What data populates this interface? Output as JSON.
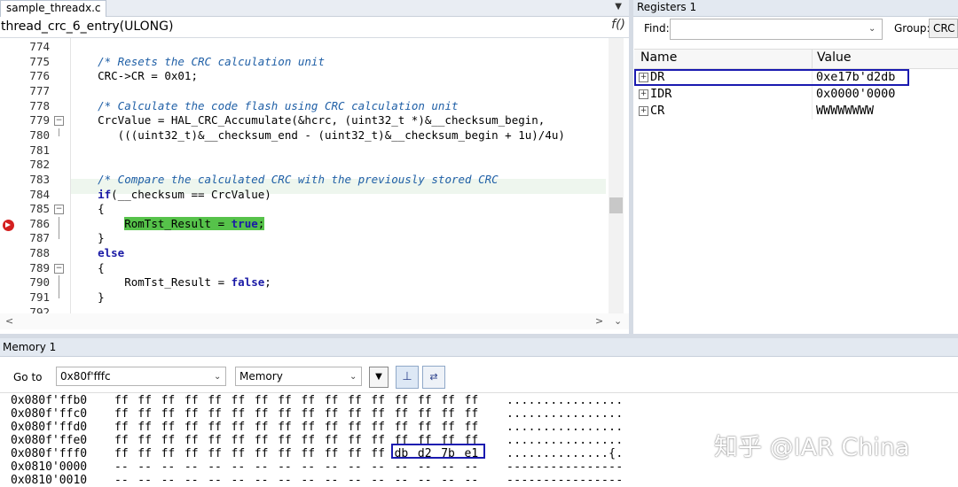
{
  "editor": {
    "tab_label": "sample_threadx.c",
    "tab_dropdown_icon": "▼",
    "function_name": "thread_crc_6_entry(ULONG)",
    "function_icon": "f()",
    "lines": [
      {
        "n": "774",
        "code": ""
      },
      {
        "n": "775",
        "code": "    /* Resets the CRC calculation unit"
      },
      {
        "n": "776",
        "code": "    CRC->CR = 0x01;"
      },
      {
        "n": "777",
        "code": ""
      },
      {
        "n": "778",
        "code": "    /* Calculate the code flash using CRC calculation unit"
      },
      {
        "n": "779",
        "code": "    CrcValue = HAL_CRC_Accumulate(&hcrc, (uint32_t *)&__checksum_begin,"
      },
      {
        "n": "780",
        "code": "       (((uint32_t)&__checksum_end - (uint32_t)&__checksum_begin + 1u)/4u)"
      },
      {
        "n": "781",
        "code": ""
      },
      {
        "n": "782",
        "code": ""
      },
      {
        "n": "783",
        "code": "    /* Compare the calculated CRC with the previously stored CRC"
      },
      {
        "n": "784",
        "code": "    if(__checksum == CrcValue)"
      },
      {
        "n": "785",
        "code": "    {"
      },
      {
        "n": "786",
        "code": "        RomTst_Result = true;"
      },
      {
        "n": "787",
        "code": "    }"
      },
      {
        "n": "788",
        "code": "    else"
      },
      {
        "n": "789",
        "code": "    {"
      },
      {
        "n": "790",
        "code": "        RomTst_Result = false;"
      },
      {
        "n": "791",
        "code": "    }"
      },
      {
        "n": "792",
        "code": ""
      }
    ]
  },
  "registers": {
    "title": "Registers 1",
    "find_label": "Find:",
    "find_value": "",
    "group_label": "Group:",
    "group_value": "CRC",
    "col_name": "Name",
    "col_value": "Value",
    "rows": [
      {
        "name": "DR",
        "value": "0xe17b'd2db"
      },
      {
        "name": "IDR",
        "value": "0x0000'0000"
      },
      {
        "name": "CR",
        "value": "WWWWWWWW"
      }
    ]
  },
  "memory": {
    "title": "Memory 1",
    "goto_label": "Go to",
    "goto_value": "0x80f'fffc",
    "memory_type": "Memory",
    "rows": [
      {
        "addr": "0x080f'ffb0",
        "bytes": [
          "ff",
          "ff",
          "ff",
          "ff",
          "ff",
          "ff",
          "ff",
          "ff",
          "ff",
          "ff",
          "ff",
          "ff",
          "ff",
          "ff",
          "ff",
          "ff"
        ],
        "ascii": "................"
      },
      {
        "addr": "0x080f'ffc0",
        "bytes": [
          "ff",
          "ff",
          "ff",
          "ff",
          "ff",
          "ff",
          "ff",
          "ff",
          "ff",
          "ff",
          "ff",
          "ff",
          "ff",
          "ff",
          "ff",
          "ff"
        ],
        "ascii": "................"
      },
      {
        "addr": "0x080f'ffd0",
        "bytes": [
          "ff",
          "ff",
          "ff",
          "ff",
          "ff",
          "ff",
          "ff",
          "ff",
          "ff",
          "ff",
          "ff",
          "ff",
          "ff",
          "ff",
          "ff",
          "ff"
        ],
        "ascii": "................"
      },
      {
        "addr": "0x080f'ffe0",
        "bytes": [
          "ff",
          "ff",
          "ff",
          "ff",
          "ff",
          "ff",
          "ff",
          "ff",
          "ff",
          "ff",
          "ff",
          "ff",
          "ff",
          "ff",
          "ff",
          "ff"
        ],
        "ascii": "................"
      },
      {
        "addr": "0x080f'fff0",
        "bytes": [
          "ff",
          "ff",
          "ff",
          "ff",
          "ff",
          "ff",
          "ff",
          "ff",
          "ff",
          "ff",
          "ff",
          "ff",
          "db",
          "d2",
          "7b",
          "e1"
        ],
        "ascii": "..............{."
      },
      {
        "addr": "0x0810'0000",
        "bytes": [
          "--",
          "--",
          "--",
          "--",
          "--",
          "--",
          "--",
          "--",
          "--",
          "--",
          "--",
          "--",
          "--",
          "--",
          "--",
          "--"
        ],
        "ascii": "----------------"
      },
      {
        "addr": "0x0810'0010",
        "bytes": [
          "--",
          "--",
          "--",
          "--",
          "--",
          "--",
          "--",
          "--",
          "--",
          "--",
          "--",
          "--",
          "--",
          "--",
          "--",
          "--"
        ],
        "ascii": "----------------"
      }
    ]
  },
  "watermark": "知乎 @IAR China"
}
